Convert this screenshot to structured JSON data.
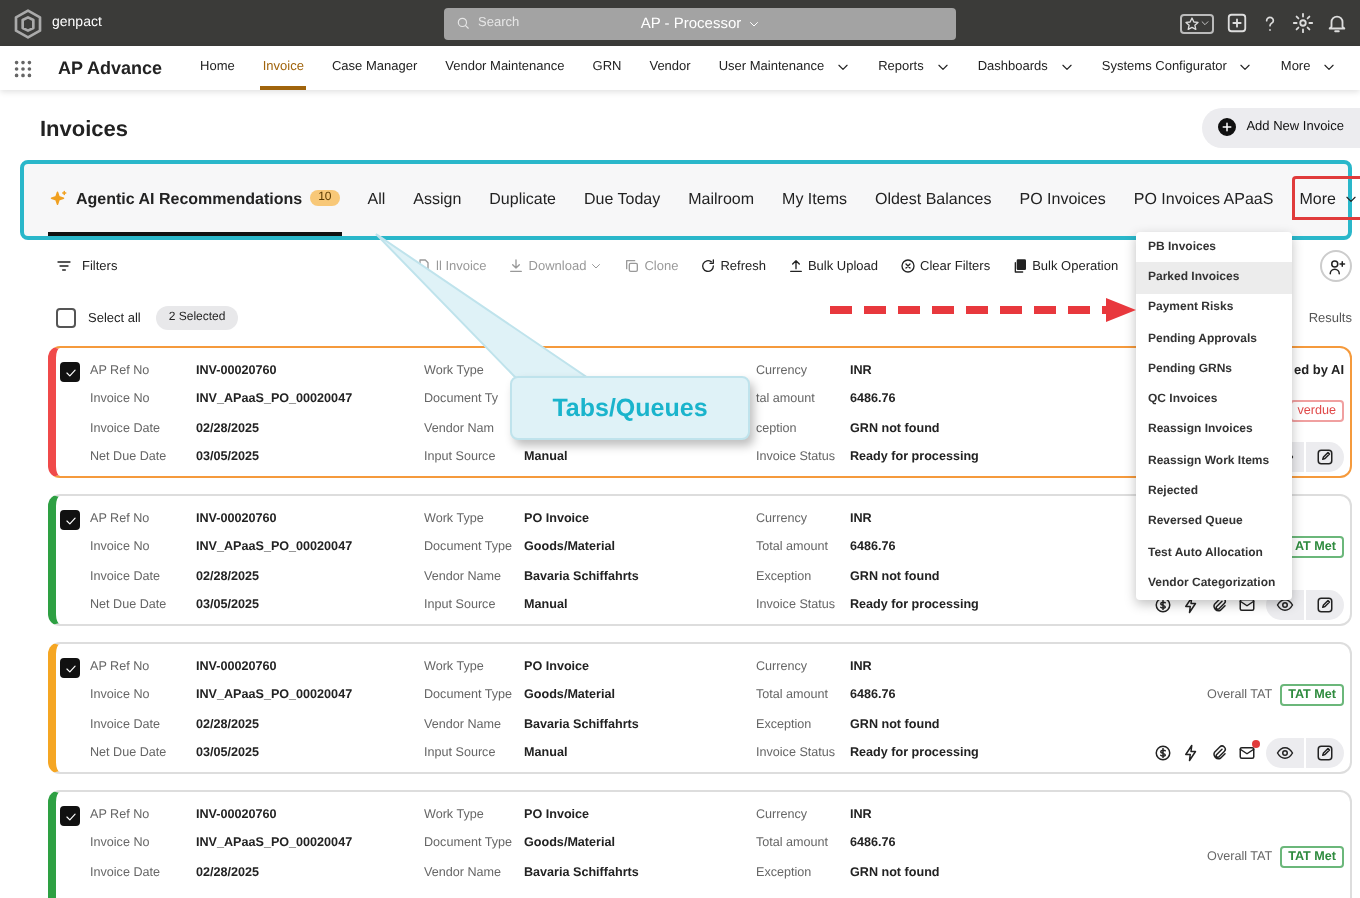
{
  "topbar": {
    "logo": "genpact",
    "search": {
      "placeholder": "Search"
    },
    "role": "AP - Processor"
  },
  "nav": {
    "app_title": "AP Advance",
    "items": [
      {
        "label": "Home",
        "selected": false,
        "dropdown": false
      },
      {
        "label": "Invoice",
        "selected": true,
        "dropdown": false
      },
      {
        "label": "Case Manager",
        "selected": false,
        "dropdown": false
      },
      {
        "label": "Vendor Maintenance",
        "selected": false,
        "dropdown": false
      },
      {
        "label": "GRN",
        "selected": false,
        "dropdown": false
      },
      {
        "label": "Vendor",
        "selected": false,
        "dropdown": false
      },
      {
        "label": "User Maintenance",
        "selected": false,
        "dropdown": true
      },
      {
        "label": "Reports",
        "selected": false,
        "dropdown": true
      },
      {
        "label": "Dashboards",
        "selected": false,
        "dropdown": true
      },
      {
        "label": "Systems Configurator",
        "selected": false,
        "dropdown": true
      },
      {
        "label": "More",
        "selected": false,
        "dropdown": true
      }
    ]
  },
  "page": {
    "title": "Invoices",
    "add_button": "Add New Invoice"
  },
  "tabs": {
    "annotated": true,
    "items": [
      {
        "kind": "ai",
        "label": "Agentic AI Recommendations",
        "badge": "10",
        "selected": true,
        "annotated": false
      },
      {
        "kind": "queue",
        "label": "All",
        "selected": false,
        "annotated": false
      },
      {
        "kind": "queue",
        "label": "Assign",
        "selected": false,
        "annotated": false
      },
      {
        "kind": "queue",
        "label": "Duplicate",
        "selected": false,
        "annotated": false
      },
      {
        "kind": "queue",
        "label": "Due Today",
        "selected": false,
        "annotated": false
      },
      {
        "kind": "queue",
        "label": "Mailroom",
        "selected": false,
        "annotated": false
      },
      {
        "kind": "queue",
        "label": "My Items",
        "selected": false,
        "annotated": false
      },
      {
        "kind": "queue",
        "label": "Oldest Balances",
        "selected": false,
        "annotated": false
      },
      {
        "kind": "queue",
        "label": "PO Invoices",
        "selected": false,
        "annotated": false
      },
      {
        "kind": "queue",
        "label": "PO Invoices APaaS",
        "selected": false,
        "annotated": false
      },
      {
        "kind": "more",
        "label": "More",
        "selected": false,
        "annotated": true
      }
    ]
  },
  "toolbar": {
    "filters": "Filters",
    "actions": [
      {
        "label": "ll Invoice",
        "disabled": true,
        "dropdown": false
      },
      {
        "label": "Download",
        "disabled": true,
        "dropdown": true
      },
      {
        "label": "Clone",
        "disabled": true,
        "dropdown": false
      },
      {
        "label": "Refresh",
        "disabled": false,
        "dropdown": false
      },
      {
        "label": "Bulk Upload",
        "disabled": false,
        "dropdown": false
      },
      {
        "label": "Clear Filters",
        "disabled": false,
        "dropdown": false
      },
      {
        "label": "Bulk Operation",
        "disabled": false,
        "dropdown": false
      }
    ]
  },
  "selection": {
    "select_all": "Select all",
    "checked": false,
    "selected_count": "2 Selected",
    "results": "Results"
  },
  "cards": [
    {
      "color": "#f04a4a",
      "highlighted": true,
      "checked": true,
      "actions": true,
      "note": "ed by AI",
      "badge": {
        "kind": "overdue",
        "label": "verdue"
      },
      "columns": [
        [
          {
            "label": "AP Ref No",
            "value": "INV-00020760"
          },
          {
            "label": "Invoice No",
            "value": "INV_APaaS_PO_00020047"
          },
          {
            "label": "Invoice Date",
            "value": "02/28/2025"
          },
          {
            "label": "Net Due Date",
            "value": "03/05/2025"
          }
        ],
        [
          {
            "label": "Work Type"
          },
          {
            "label": "Document Ty"
          },
          {
            "label": "Vendor Nam"
          },
          {
            "label": "Input Source",
            "value": "Manual"
          }
        ],
        [
          {
            "label": "Currency",
            "value": "INR"
          },
          {
            "label": "tal amount",
            "value": "6486.76"
          },
          {
            "label": "ception",
            "value": "GRN not found"
          },
          {
            "label": "Invoice Status",
            "value": "Ready for processing"
          }
        ]
      ]
    },
    {
      "color": "#2ea043",
      "highlighted": false,
      "checked": true,
      "actions": true,
      "badge": {
        "kind": "met",
        "label": "AT Met"
      },
      "columns": [
        [
          {
            "label": "AP Ref No",
            "value": "INV-00020760"
          },
          {
            "label": "Invoice No",
            "value": "INV_APaaS_PO_00020047"
          },
          {
            "label": "Invoice Date",
            "value": "02/28/2025"
          },
          {
            "label": "Net Due Date",
            "value": "03/05/2025"
          }
        ],
        [
          {
            "label": "Work Type",
            "value": "PO Invoice"
          },
          {
            "label": "Document Type",
            "value": "Goods/Material"
          },
          {
            "label": "Vendor Name",
            "value": "Bavaria Schiffahrts"
          },
          {
            "label": "Input Source",
            "value": "Manual"
          }
        ],
        [
          {
            "label": "Currency",
            "value": "INR"
          },
          {
            "label": "Total amount",
            "value": "6486.76"
          },
          {
            "label": "Exception",
            "value": "GRN not found"
          },
          {
            "label": "Invoice Status",
            "value": "Ready for processing"
          }
        ]
      ]
    },
    {
      "color": "#f5a623",
      "highlighted": false,
      "checked": true,
      "actions": true,
      "tat_label": "Overall TAT",
      "badge": {
        "kind": "met",
        "label": "TAT Met"
      },
      "columns": [
        [
          {
            "label": "AP Ref No",
            "value": "INV-00020760"
          },
          {
            "label": "Invoice No",
            "value": "INV_APaaS_PO_00020047"
          },
          {
            "label": "Invoice Date",
            "value": "02/28/2025"
          },
          {
            "label": "Net Due Date",
            "value": "03/05/2025"
          }
        ],
        [
          {
            "label": "Work Type",
            "value": "PO Invoice"
          },
          {
            "label": "Document Type",
            "value": "Goods/Material"
          },
          {
            "label": "Vendor Name",
            "value": "Bavaria Schiffahrts"
          },
          {
            "label": "Input Source",
            "value": "Manual"
          }
        ],
        [
          {
            "label": "Currency",
            "value": "INR"
          },
          {
            "label": "Total amount",
            "value": "6486.76"
          },
          {
            "label": "Exception",
            "value": "GRN not found"
          },
          {
            "label": "Invoice Status",
            "value": "Ready for processing"
          }
        ]
      ]
    },
    {
      "color": "#2ea043",
      "highlighted": false,
      "checked": true,
      "actions": false,
      "tat_label": "Overall TAT",
      "badge": {
        "kind": "met",
        "label": "TAT Met"
      },
      "columns": [
        [
          {
            "label": "AP Ref No",
            "value": "INV-00020760"
          },
          {
            "label": "Invoice No",
            "value": "INV_APaaS_PO_00020047"
          },
          {
            "label": "Invoice Date",
            "value": "02/28/2025"
          }
        ],
        [
          {
            "label": "Work Type",
            "value": "PO Invoice"
          },
          {
            "label": "Document Type",
            "value": "Goods/Material"
          },
          {
            "label": "Vendor Name",
            "value": "Bavaria Schiffahrts"
          }
        ],
        [
          {
            "label": "Currency",
            "value": "INR"
          },
          {
            "label": "Total amount",
            "value": "6486.76"
          },
          {
            "label": "Exception",
            "value": "GRN not found"
          }
        ]
      ]
    }
  ],
  "menu": {
    "items": [
      {
        "label": "PB Invoices",
        "selected": false
      },
      {
        "label": "Parked Invoices",
        "selected": true
      },
      {
        "label": "Payment Risks",
        "selected": false
      },
      {
        "label": "Pending Approvals",
        "selected": false
      },
      {
        "label": "Pending GRNs",
        "selected": false
      },
      {
        "label": "QC Invoices",
        "selected": false
      },
      {
        "label": "Reassign Invoices",
        "selected": false
      },
      {
        "label": "Reassign Work Items",
        "selected": false
      },
      {
        "label": "Rejected",
        "selected": false
      },
      {
        "label": "Reversed Queue",
        "selected": false
      },
      {
        "label": "Test Auto Allocation",
        "selected": false
      },
      {
        "label": "Vendor Categorization",
        "selected": false
      }
    ]
  },
  "annotation": {
    "callout": "Tabs/Queues"
  }
}
